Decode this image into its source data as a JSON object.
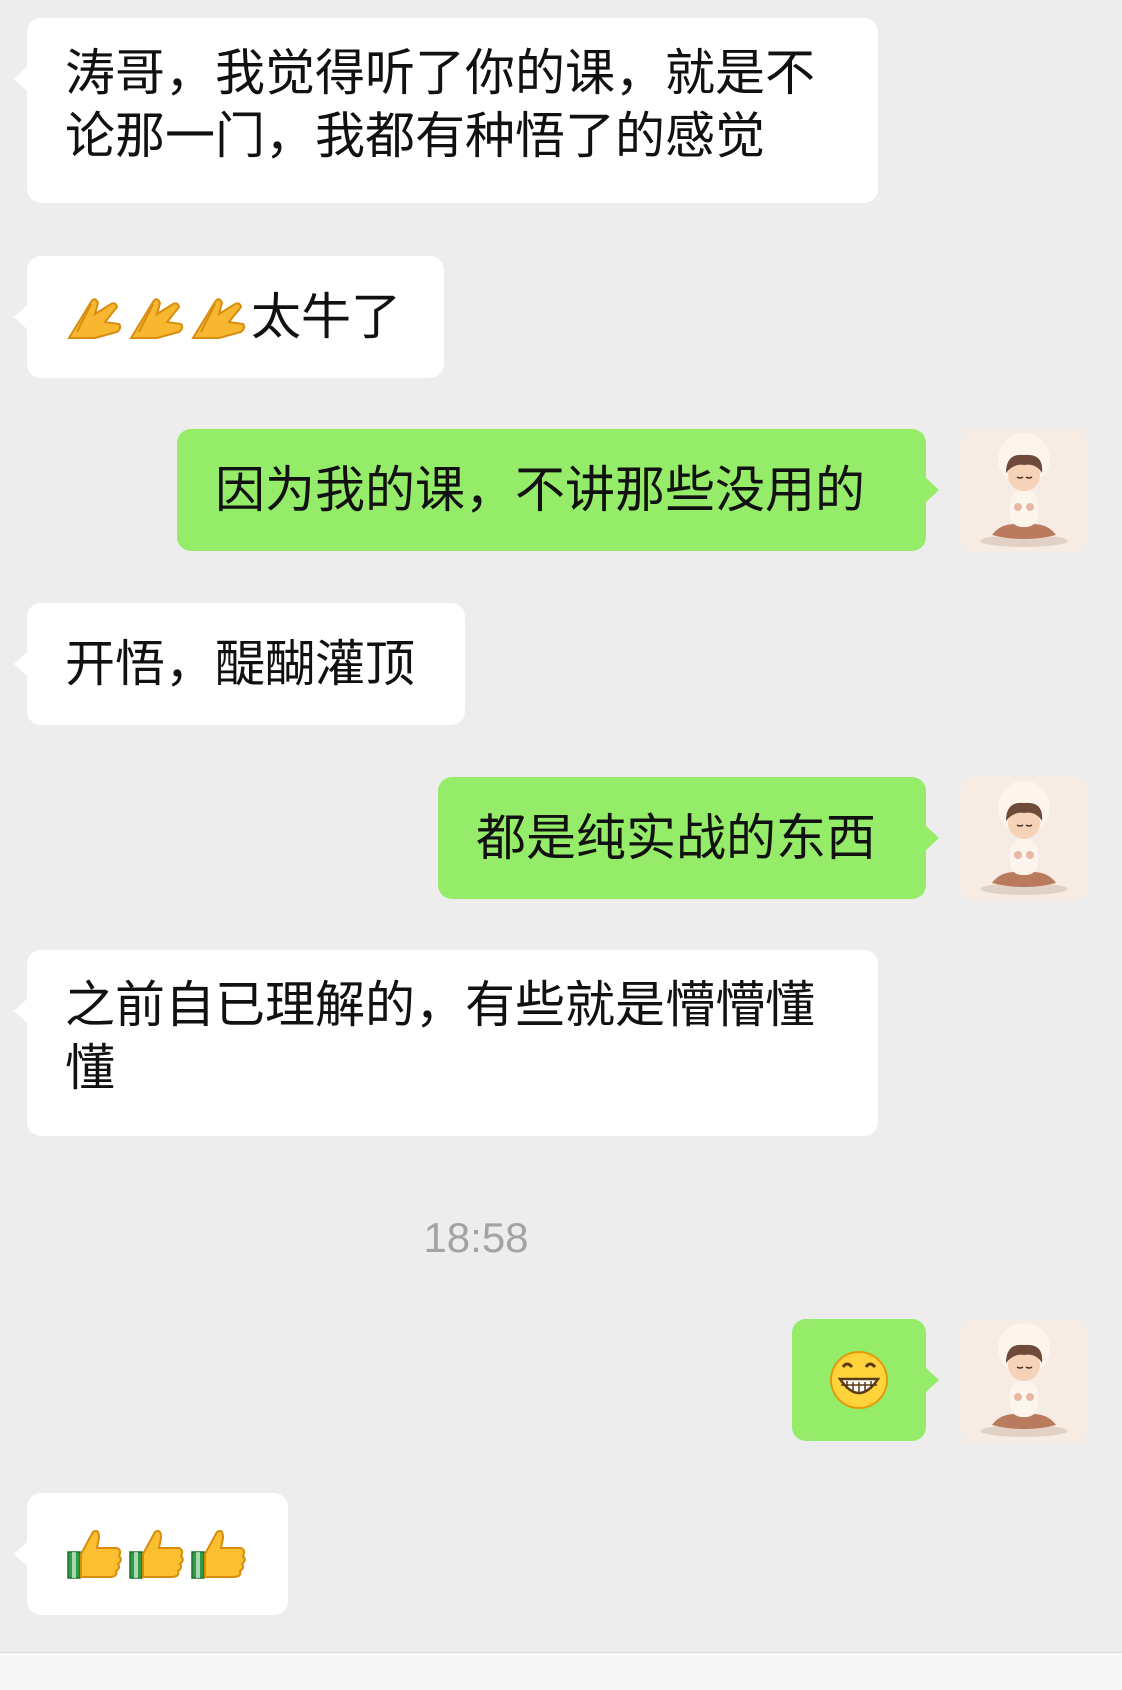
{
  "messages": [
    {
      "side": "in",
      "text": "涛哥，我觉得听了你的课，就是不论那一门，我都有种悟了的感觉"
    },
    {
      "side": "in",
      "emoji": "folded-hands-icon",
      "emoji_count": 3,
      "text": "太牛了"
    },
    {
      "side": "out",
      "text": "因为我的课，不讲那些没用的"
    },
    {
      "side": "in",
      "text": "开悟，醍醐灌顶"
    },
    {
      "side": "out",
      "text": "都是纯实战的东西"
    },
    {
      "side": "in",
      "text": "之前自已理解的，有些就是懵懵懂懂"
    },
    {
      "side": "out",
      "emoji": "grinning-face-icon",
      "emoji_count": 1
    },
    {
      "side": "in",
      "emoji": "thumbs-up-icon",
      "emoji_count": 3
    }
  ],
  "timestamp": "18:58",
  "colors": {
    "incoming_bubble": "#ffffff",
    "outgoing_bubble": "#95ec69",
    "background": "#ededed",
    "timestamp_text": "#a3a3a3"
  },
  "avatar": {
    "icon": "meditating-boy-avatar"
  }
}
